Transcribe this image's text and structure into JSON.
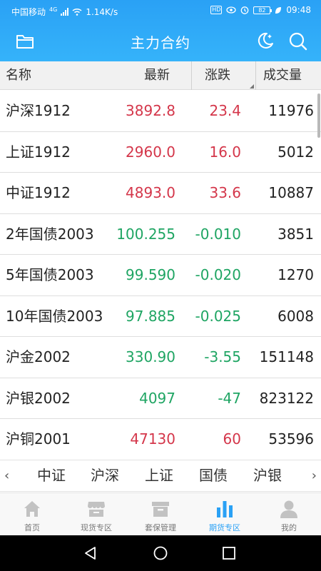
{
  "status_bar": {
    "carrier": "中国移动",
    "network": "4G",
    "speed": "1.14K/s",
    "hd": "HD",
    "battery": "82",
    "time": "09:48"
  },
  "header": {
    "title": "主力合约"
  },
  "columns": {
    "name": "名称",
    "latest": "最新",
    "change": "涨跌",
    "volume": "成交量"
  },
  "rows": [
    {
      "name": "沪深1912",
      "latest": "3892.8",
      "change": "23.4",
      "volume": "11976",
      "trend": "up"
    },
    {
      "name": "上证1912",
      "latest": "2960.0",
      "change": "16.0",
      "volume": "5012",
      "trend": "up"
    },
    {
      "name": "中证1912",
      "latest": "4893.0",
      "change": "33.6",
      "volume": "10887",
      "trend": "up"
    },
    {
      "name": "2年国债2003",
      "latest": "100.255",
      "change": "-0.010",
      "volume": "3851",
      "trend": "down"
    },
    {
      "name": "5年国债2003",
      "latest": "99.590",
      "change": "-0.020",
      "volume": "1270",
      "trend": "down"
    },
    {
      "name": "10年国债2003",
      "latest": "97.885",
      "change": "-0.025",
      "volume": "6008",
      "trend": "down"
    },
    {
      "name": "沪金2002",
      "latest": "330.90",
      "change": "-3.55",
      "volume": "151148",
      "trend": "down"
    },
    {
      "name": "沪银2002",
      "latest": "4097",
      "change": "-47",
      "volume": "823122",
      "trend": "down"
    },
    {
      "name": "沪铜2001",
      "latest": "47130",
      "change": "60",
      "volume": "53596",
      "trend": "up"
    }
  ],
  "categories": {
    "left_arrow": "‹",
    "right_arrow": "›",
    "items": [
      "中证",
      "沪深",
      "上证",
      "国债",
      "沪银"
    ]
  },
  "bottom_nav": [
    {
      "label": "首页",
      "icon": "home-icon",
      "active": false
    },
    {
      "label": "现货专区",
      "icon": "store-icon",
      "active": false
    },
    {
      "label": "套保管理",
      "icon": "archive-box-icon",
      "active": false
    },
    {
      "label": "期货专区",
      "icon": "bar-chart-icon",
      "active": true
    },
    {
      "label": "我的",
      "icon": "user-icon",
      "active": false
    }
  ],
  "colors": {
    "accent": "#2aa1f5",
    "up": "#d4364a",
    "down": "#1fa563"
  }
}
